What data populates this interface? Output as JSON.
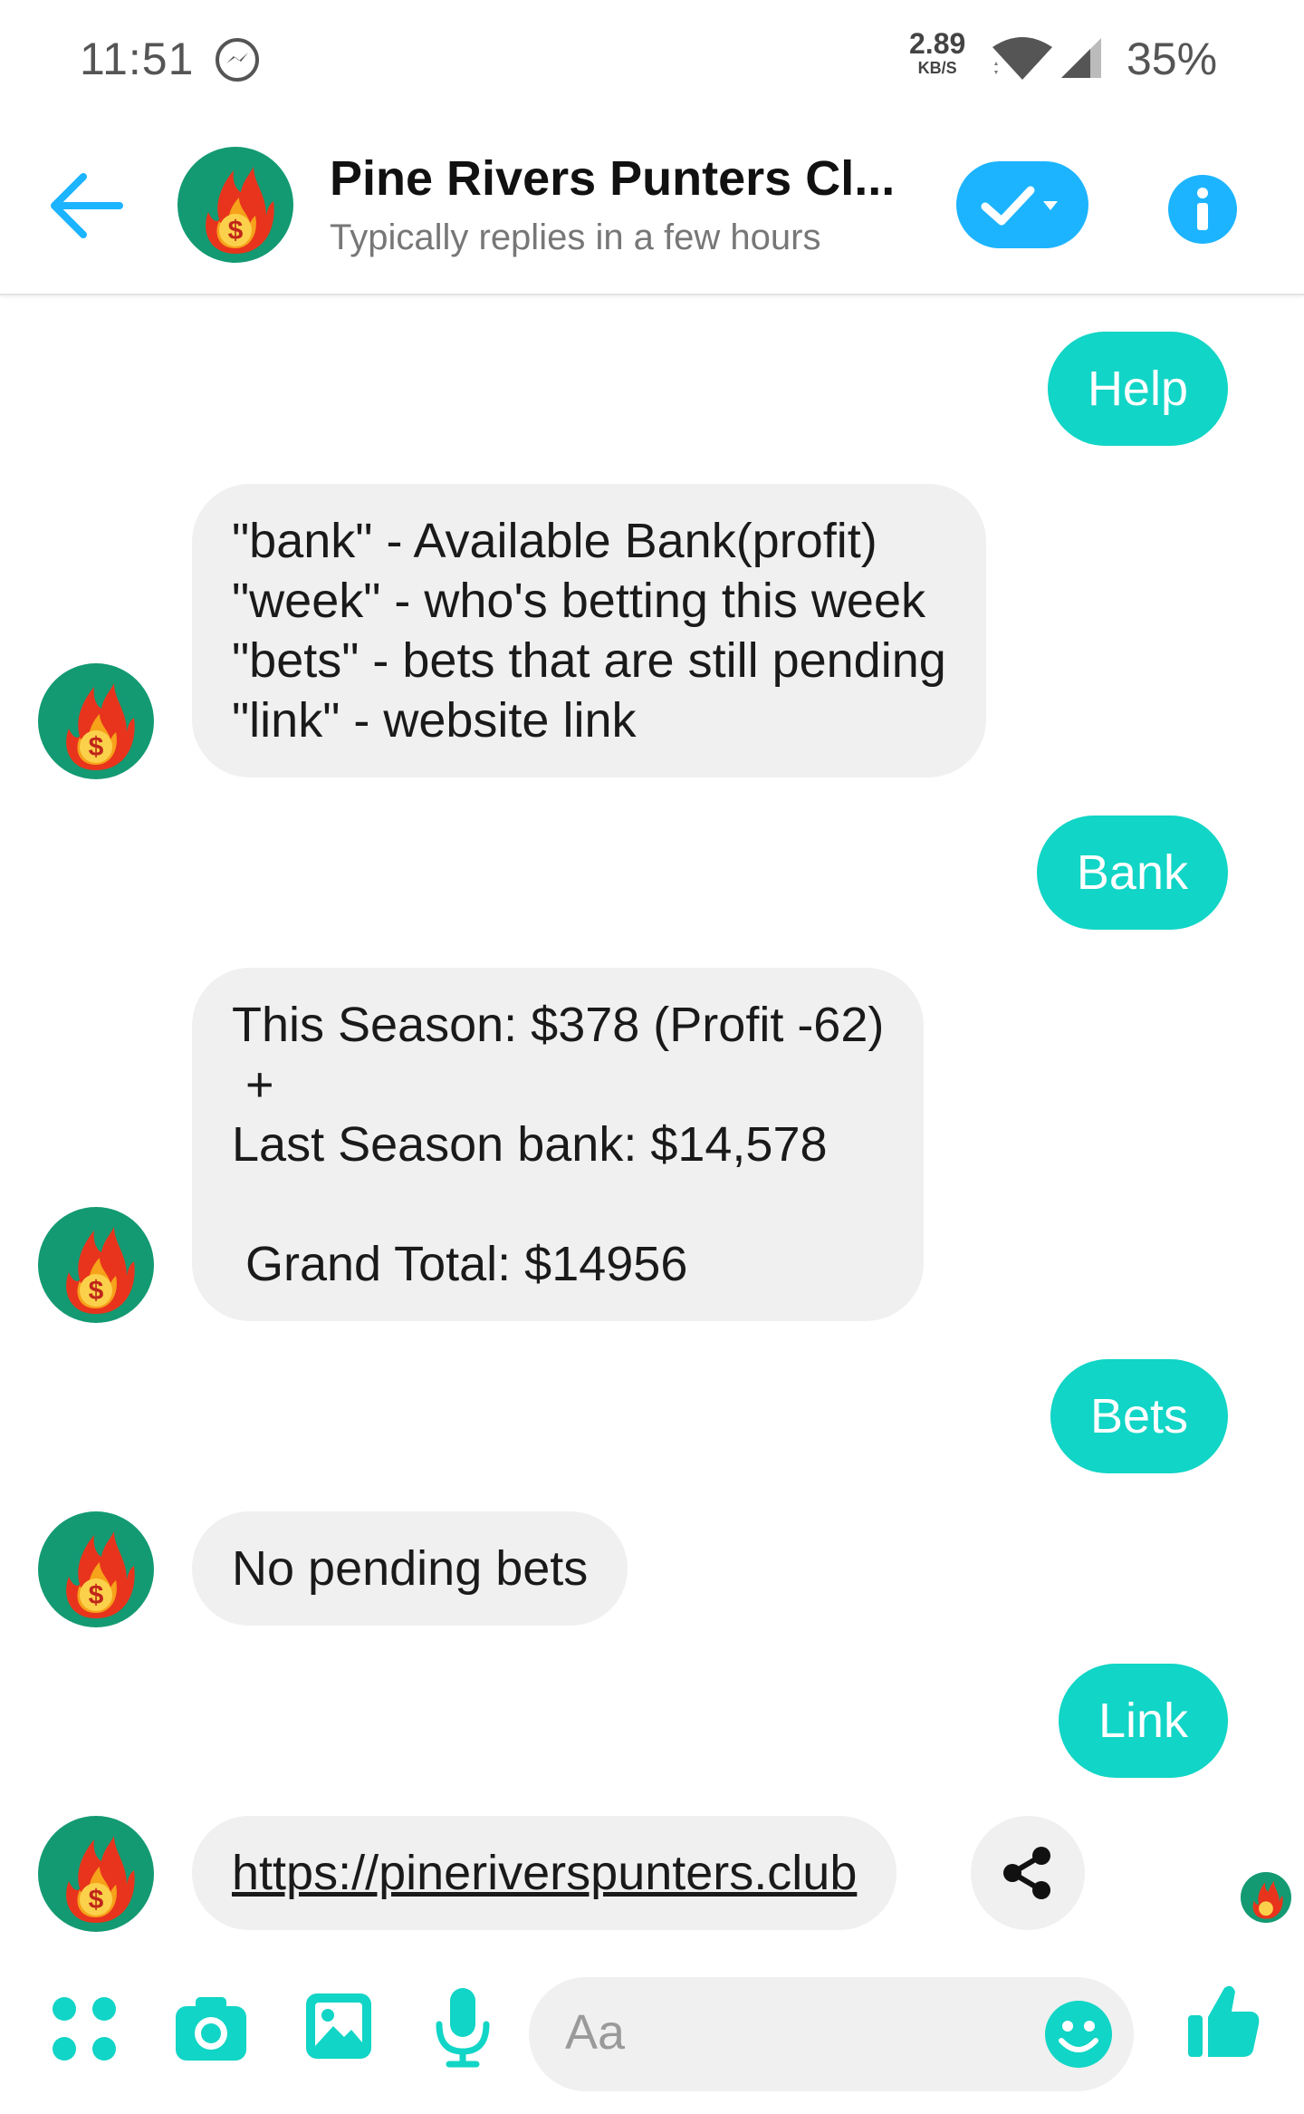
{
  "status_bar": {
    "time": "11:51",
    "speed_value": "2.89",
    "speed_unit": "KB/S",
    "battery": "35%",
    "icons": [
      "messenger-icon",
      "wifi-icon",
      "cell-signal-icon"
    ]
  },
  "header": {
    "title": "Pine Rivers Punters Cl...",
    "subtitle": "Typically replies in a few hours",
    "accent_color": "#1cb4ff"
  },
  "messages": [
    {
      "from": "me",
      "text": "Help"
    },
    {
      "from": "them",
      "text": "\"bank\" - Available Bank(profit)\n\"week\" - who's betting this week\n\"bets\" - bets that are still pending\n\"link\" - website link"
    },
    {
      "from": "me",
      "text": "Bank"
    },
    {
      "from": "them",
      "text": "This Season: $378 (Profit -62)\n +\nLast Season bank: $14,578\n\n Grand Total: $14956"
    },
    {
      "from": "me",
      "text": "Bets"
    },
    {
      "from": "them",
      "text": "No pending bets"
    },
    {
      "from": "me",
      "text": "Link"
    },
    {
      "from": "them",
      "text": "https://pineriverspunters.club"
    }
  ],
  "composer": {
    "placeholder": "Aa",
    "icons": [
      "apps-icon",
      "camera-icon",
      "gallery-icon",
      "microphone-icon",
      "emoji-icon",
      "thumbs-up-icon"
    ]
  },
  "colors": {
    "outgoing_bubble": "#11d5c6",
    "incoming_bubble": "#f0f0f0",
    "composer_icon": "#11d5c6"
  }
}
